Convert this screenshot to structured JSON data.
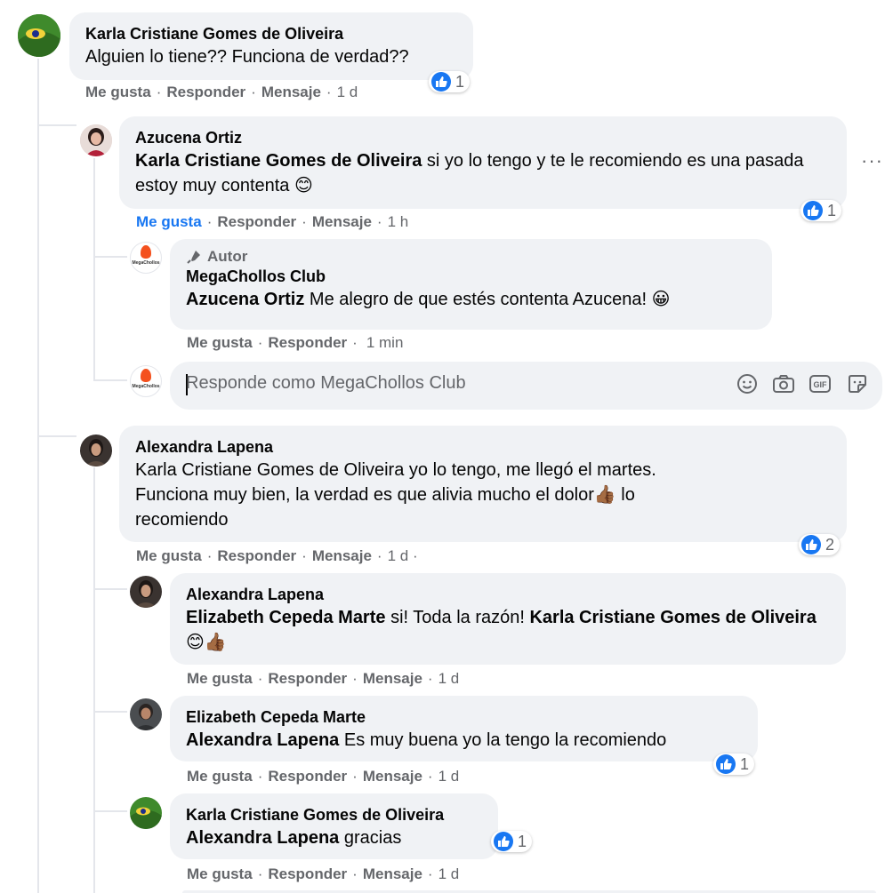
{
  "comments": [
    {
      "author": "Karla Cristiane Gomes de Oliveira",
      "text": "Alguien lo tiene?? Funciona de verdad??",
      "like": "Me gusta",
      "reply": "Responder",
      "message": "Mensaje",
      "time": "1 d",
      "reactions": "1"
    },
    {
      "author": "Azucena Ortiz",
      "mention": "Karla Cristiane Gomes de Oliveira",
      "text": " si yo lo tengo y te le recomiendo es una pasada estoy muy contenta 😊",
      "like": "Me gusta",
      "reply": "Responder",
      "message": "Mensaje",
      "time": "1 h",
      "reactions": "1",
      "more": "···"
    },
    {
      "badge": "Autor",
      "author": "MegaChollos Club",
      "mention": "Azucena Ortiz",
      "text": " Me alegro de que estés contenta Azucena! 😀",
      "like": "Me gusta",
      "reply": "Responder",
      "time": "1 min",
      "logo_text": "MegaChollos"
    },
    {
      "author": "Alexandra Lapena",
      "text": "Karla Cristiane Gomes de Oliveira yo lo tengo, me llegó el martes. Funciona muy bien, la verdad es que alivia mucho el dolor👍🏾 lo recomiendo",
      "like": "Me gusta",
      "reply": "Responder",
      "message": "Mensaje",
      "time": "1 d ·",
      "reactions": "2"
    },
    {
      "author": "Alexandra Lapena",
      "mention": "Elizabeth Cepeda Marte",
      "text_mid": " si! Toda la razón! ",
      "mention2": "Karla Cristiane Gomes de Oliveira",
      "text_end": " 😊👍🏾",
      "like": "Me gusta",
      "reply": "Responder",
      "message": "Mensaje",
      "time": "1 d"
    },
    {
      "author": "Elizabeth Cepeda Marte",
      "mention": "Alexandra Lapena",
      "text": " Es muy buena yo la tengo la recomiendo",
      "like": "Me gusta",
      "reply": "Responder",
      "message": "Mensaje",
      "time": "1 d",
      "reactions": "1"
    },
    {
      "author": "Karla Cristiane Gomes de Oliveira",
      "mention": "Alexandra Lapena",
      "text": " gracias",
      "like": "Me gusta",
      "reply": "Responder",
      "message": "Mensaje",
      "time": "1 d",
      "reactions": "1"
    }
  ],
  "reply_box": {
    "placeholder": "Responde como MegaChollos Club",
    "logo_text": "MegaChollos",
    "icons": [
      "emoji-icon",
      "camera-icon",
      "gif-icon",
      "sticker-icon"
    ]
  },
  "colors": {
    "bubble": "#f0f2f5",
    "like_blue": "#1877f2",
    "meta": "#65676b"
  }
}
